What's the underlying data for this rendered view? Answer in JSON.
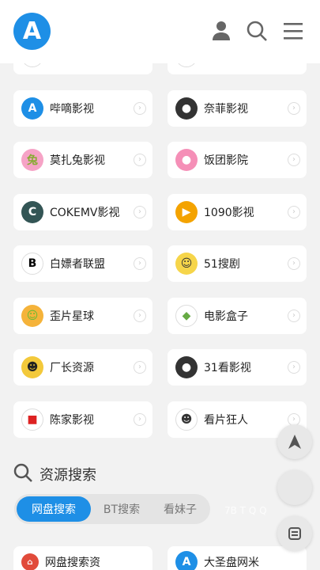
{
  "header": {
    "logo_letter": "A",
    "user_icon": "user-icon",
    "search_icon": "search-icon",
    "menu_icon": "menu-icon"
  },
  "sites": [
    {
      "name": "",
      "icon": "partial-icon"
    },
    {
      "name": "",
      "icon": "partial-icon"
    },
    {
      "name": "哔嘀影视",
      "icon": "A-logo-icon"
    },
    {
      "name": "奈菲影视",
      "icon": "globe-icon"
    },
    {
      "name": "莫扎兔影视",
      "icon": "rabbit-icon"
    },
    {
      "name": "饭团影院",
      "icon": "ticket-icon"
    },
    {
      "name": "COKEMV影视",
      "icon": "coke-icon"
    },
    {
      "name": "1090影视",
      "icon": "play-icon"
    },
    {
      "name": "白嫖者联盟",
      "icon": "b-logo-icon"
    },
    {
      "name": "51搜剧",
      "icon": "mascot-icon"
    },
    {
      "name": "歪片星球",
      "icon": "smiley-icon"
    },
    {
      "name": "电影盒子",
      "icon": "box-icon"
    },
    {
      "name": "厂长资源",
      "icon": "sunglasses-icon"
    },
    {
      "name": "31看影视",
      "icon": "globe-icon"
    },
    {
      "name": "陈家影视",
      "icon": "red-logo-icon"
    },
    {
      "name": "看片狂人",
      "icon": "face-icon"
    }
  ],
  "search_section": {
    "title": "资源搜索",
    "tabs": [
      "网盘搜索",
      "BT搜索",
      "看妹子"
    ]
  },
  "bottom_cards": [
    "网盘搜索资",
    "大圣盘网米"
  ],
  "watermark": "7B T  Q Q",
  "colors": {
    "accent": "#1e8fe6",
    "card": "#ffffff",
    "bg": "#f2f2f2"
  }
}
